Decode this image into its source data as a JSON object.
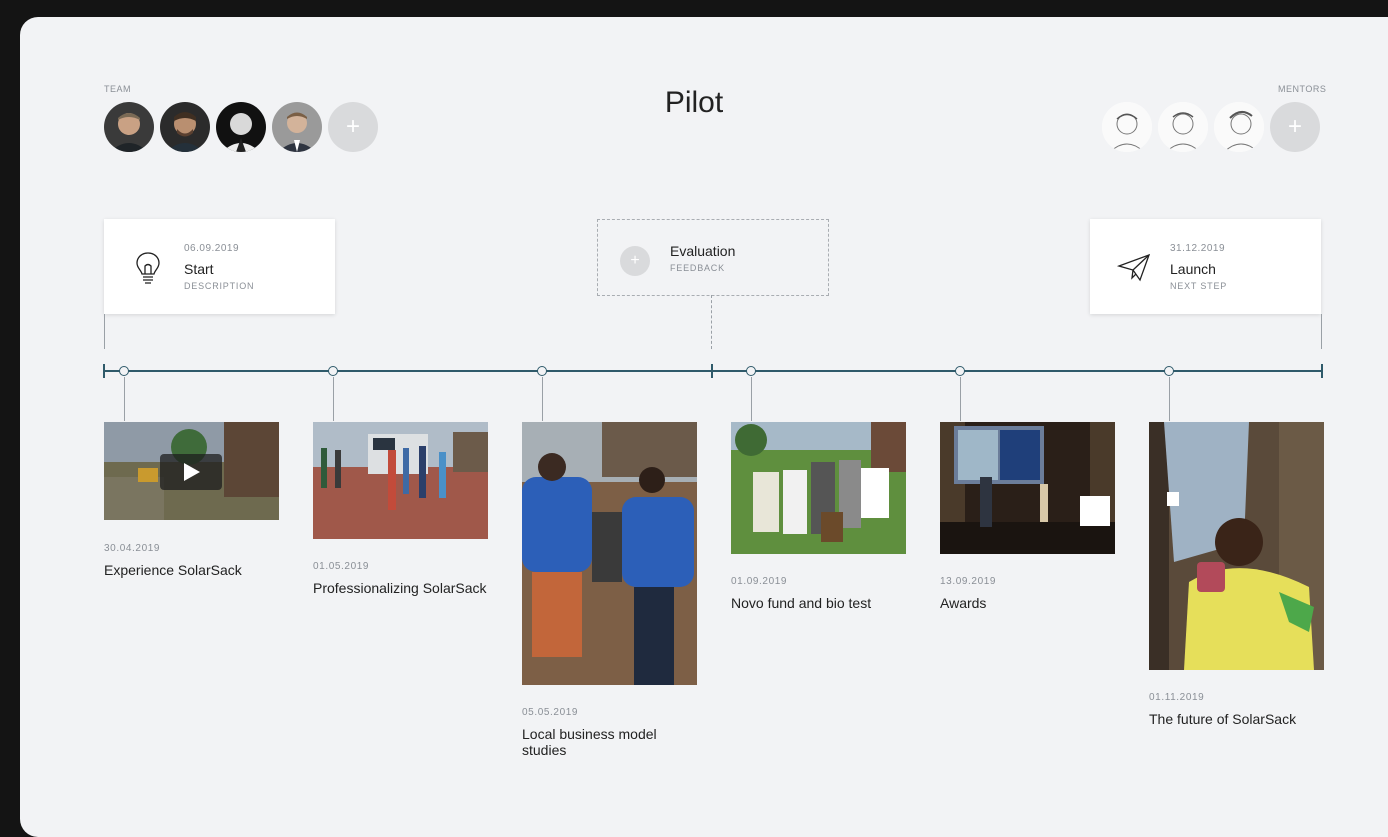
{
  "header": {
    "team_label": "TEAM",
    "mentors_label": "MENTORS",
    "title": "Pilot",
    "add_symbol": "+"
  },
  "milestones": {
    "start": {
      "date": "06.09.2019",
      "name": "Start",
      "sub": "DESCRIPTION",
      "icon": "lightbulb-icon"
    },
    "evaluation": {
      "name": "Evaluation",
      "sub": "FEEDBACK",
      "icon": "plus-icon"
    },
    "launch": {
      "date": "31.12.2019",
      "name": "Launch",
      "sub": "NEXT STEP",
      "icon": "paper-plane-icon"
    }
  },
  "items": [
    {
      "date": "30.04.2019",
      "title": "Experience SolarSack",
      "media": "video"
    },
    {
      "date": "01.05.2019",
      "title": "Professionalizing SolarSack",
      "media": "photo"
    },
    {
      "date": "05.05.2019",
      "title": "Local business model studies",
      "media": "photo"
    },
    {
      "date": "01.09.2019",
      "title": "Novo fund and bio test",
      "media": "photo"
    },
    {
      "date": "13.09.2019",
      "title": "Awards",
      "media": "photo"
    },
    {
      "date": "01.11.2019",
      "title": "The future of SolarSack",
      "media": "photo"
    }
  ],
  "colors": {
    "accent": "#2f5a6a",
    "panel": "#f2f3f5",
    "background": "#141414"
  }
}
